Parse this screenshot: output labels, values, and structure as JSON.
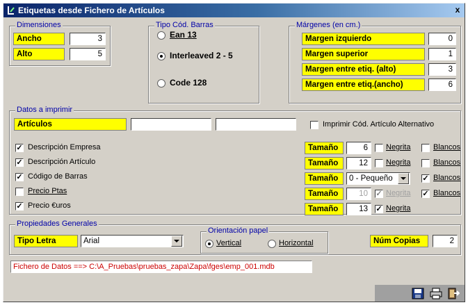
{
  "window": {
    "title": "Etiquetas desde Fichero de Artículos",
    "close_glyph": "x"
  },
  "dimensiones": {
    "legend": "Dimensiones",
    "ancho_label": "Ancho",
    "ancho_value": "3",
    "alto_label": "Alto",
    "alto_value": "5"
  },
  "barcode": {
    "legend": "Tipo Cód. Barras",
    "options": [
      {
        "label": "Ean 13",
        "selected": false
      },
      {
        "label": "Interleaved 2 - 5",
        "selected": true
      },
      {
        "label": "Code 128",
        "selected": false
      }
    ]
  },
  "margenes": {
    "legend": "Márgenes (en cm.)",
    "rows": [
      {
        "label": "Margen izquierdo",
        "value": "0"
      },
      {
        "label": "Margen superior",
        "value": "1"
      },
      {
        "label": "Margen entre etiq. (alto)",
        "value": "3"
      },
      {
        "label": "Margen entre etiq.(ancho)",
        "value": "6"
      }
    ]
  },
  "datos": {
    "legend": "Datos a imprimir",
    "articulos_label": "Artículos",
    "articulos_field1": "",
    "articulos_field2": "",
    "alt_code_label": "Imprimir Cód. Artículo Alternativo",
    "alt_code_checked": false,
    "items": [
      {
        "label": "Descripción Empresa",
        "checked": true,
        "tamano": "6",
        "negrita": false,
        "blancos": false
      },
      {
        "label": "Descripción Artículo",
        "checked": true,
        "tamano": "12",
        "negrita": false,
        "blancos": false
      },
      {
        "label": "Código de Barras",
        "checked": true,
        "tamano": "0 - Pequeño",
        "blancos": true
      },
      {
        "label": "Precio Ptas",
        "checked": false,
        "tamano": "10",
        "negrita": true,
        "blancos": true
      },
      {
        "label": "Precio €uros",
        "checked": true,
        "tamano": "13",
        "negrita": true
      }
    ],
    "tamano_label": "Tamaño",
    "negrita_label": "Negrita",
    "blancos_label": "Blancos"
  },
  "propiedades": {
    "legend": "Propiedades Generales",
    "tipo_letra_label": "Tipo Letra",
    "tipo_letra_value": "Arial",
    "orientacion_legend": "Orientación papel",
    "vertical_label": "Vertical",
    "horizontal_label": "Horizontal",
    "orientation_selected": "vertical",
    "num_copias_label": "Núm Copias",
    "num_copias_value": "2"
  },
  "status_text": "Fichero de Datos ==> C:\\A_Pruebas\\pruebas_zapa\\Zapa\\fges\\emp_001.mdb",
  "toolbar": {
    "icons": [
      "save-icon",
      "print-icon",
      "exit-icon"
    ]
  },
  "colors": {
    "label_bg": "#ffff00",
    "legend_text": "#0000a8",
    "status_text": "#cc0000",
    "window_bg": "#d4d0c8"
  }
}
